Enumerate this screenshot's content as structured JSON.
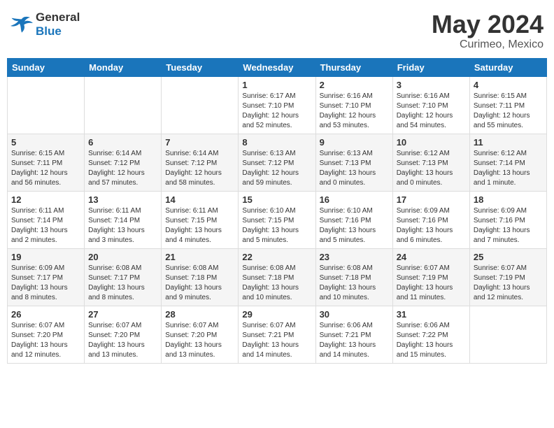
{
  "logo": {
    "text_general": "General",
    "text_blue": "Blue"
  },
  "header": {
    "month_year": "May 2024",
    "location": "Curimeo, Mexico"
  },
  "weekdays": [
    "Sunday",
    "Monday",
    "Tuesday",
    "Wednesday",
    "Thursday",
    "Friday",
    "Saturday"
  ],
  "weeks": [
    [
      {
        "day": "",
        "info": ""
      },
      {
        "day": "",
        "info": ""
      },
      {
        "day": "",
        "info": ""
      },
      {
        "day": "1",
        "info": "Sunrise: 6:17 AM\nSunset: 7:10 PM\nDaylight: 12 hours\nand 52 minutes."
      },
      {
        "day": "2",
        "info": "Sunrise: 6:16 AM\nSunset: 7:10 PM\nDaylight: 12 hours\nand 53 minutes."
      },
      {
        "day": "3",
        "info": "Sunrise: 6:16 AM\nSunset: 7:10 PM\nDaylight: 12 hours\nand 54 minutes."
      },
      {
        "day": "4",
        "info": "Sunrise: 6:15 AM\nSunset: 7:11 PM\nDaylight: 12 hours\nand 55 minutes."
      }
    ],
    [
      {
        "day": "5",
        "info": "Sunrise: 6:15 AM\nSunset: 7:11 PM\nDaylight: 12 hours\nand 56 minutes."
      },
      {
        "day": "6",
        "info": "Sunrise: 6:14 AM\nSunset: 7:12 PM\nDaylight: 12 hours\nand 57 minutes."
      },
      {
        "day": "7",
        "info": "Sunrise: 6:14 AM\nSunset: 7:12 PM\nDaylight: 12 hours\nand 58 minutes."
      },
      {
        "day": "8",
        "info": "Sunrise: 6:13 AM\nSunset: 7:12 PM\nDaylight: 12 hours\nand 59 minutes."
      },
      {
        "day": "9",
        "info": "Sunrise: 6:13 AM\nSunset: 7:13 PM\nDaylight: 13 hours\nand 0 minutes."
      },
      {
        "day": "10",
        "info": "Sunrise: 6:12 AM\nSunset: 7:13 PM\nDaylight: 13 hours\nand 0 minutes."
      },
      {
        "day": "11",
        "info": "Sunrise: 6:12 AM\nSunset: 7:14 PM\nDaylight: 13 hours\nand 1 minute."
      }
    ],
    [
      {
        "day": "12",
        "info": "Sunrise: 6:11 AM\nSunset: 7:14 PM\nDaylight: 13 hours\nand 2 minutes."
      },
      {
        "day": "13",
        "info": "Sunrise: 6:11 AM\nSunset: 7:14 PM\nDaylight: 13 hours\nand 3 minutes."
      },
      {
        "day": "14",
        "info": "Sunrise: 6:11 AM\nSunset: 7:15 PM\nDaylight: 13 hours\nand 4 minutes."
      },
      {
        "day": "15",
        "info": "Sunrise: 6:10 AM\nSunset: 7:15 PM\nDaylight: 13 hours\nand 5 minutes."
      },
      {
        "day": "16",
        "info": "Sunrise: 6:10 AM\nSunset: 7:16 PM\nDaylight: 13 hours\nand 5 minutes."
      },
      {
        "day": "17",
        "info": "Sunrise: 6:09 AM\nSunset: 7:16 PM\nDaylight: 13 hours\nand 6 minutes."
      },
      {
        "day": "18",
        "info": "Sunrise: 6:09 AM\nSunset: 7:16 PM\nDaylight: 13 hours\nand 7 minutes."
      }
    ],
    [
      {
        "day": "19",
        "info": "Sunrise: 6:09 AM\nSunset: 7:17 PM\nDaylight: 13 hours\nand 8 minutes."
      },
      {
        "day": "20",
        "info": "Sunrise: 6:08 AM\nSunset: 7:17 PM\nDaylight: 13 hours\nand 8 minutes."
      },
      {
        "day": "21",
        "info": "Sunrise: 6:08 AM\nSunset: 7:18 PM\nDaylight: 13 hours\nand 9 minutes."
      },
      {
        "day": "22",
        "info": "Sunrise: 6:08 AM\nSunset: 7:18 PM\nDaylight: 13 hours\nand 10 minutes."
      },
      {
        "day": "23",
        "info": "Sunrise: 6:08 AM\nSunset: 7:18 PM\nDaylight: 13 hours\nand 10 minutes."
      },
      {
        "day": "24",
        "info": "Sunrise: 6:07 AM\nSunset: 7:19 PM\nDaylight: 13 hours\nand 11 minutes."
      },
      {
        "day": "25",
        "info": "Sunrise: 6:07 AM\nSunset: 7:19 PM\nDaylight: 13 hours\nand 12 minutes."
      }
    ],
    [
      {
        "day": "26",
        "info": "Sunrise: 6:07 AM\nSunset: 7:20 PM\nDaylight: 13 hours\nand 12 minutes."
      },
      {
        "day": "27",
        "info": "Sunrise: 6:07 AM\nSunset: 7:20 PM\nDaylight: 13 hours\nand 13 minutes."
      },
      {
        "day": "28",
        "info": "Sunrise: 6:07 AM\nSunset: 7:20 PM\nDaylight: 13 hours\nand 13 minutes."
      },
      {
        "day": "29",
        "info": "Sunrise: 6:07 AM\nSunset: 7:21 PM\nDaylight: 13 hours\nand 14 minutes."
      },
      {
        "day": "30",
        "info": "Sunrise: 6:06 AM\nSunset: 7:21 PM\nDaylight: 13 hours\nand 14 minutes."
      },
      {
        "day": "31",
        "info": "Sunrise: 6:06 AM\nSunset: 7:22 PM\nDaylight: 13 hours\nand 15 minutes."
      },
      {
        "day": "",
        "info": ""
      }
    ]
  ]
}
